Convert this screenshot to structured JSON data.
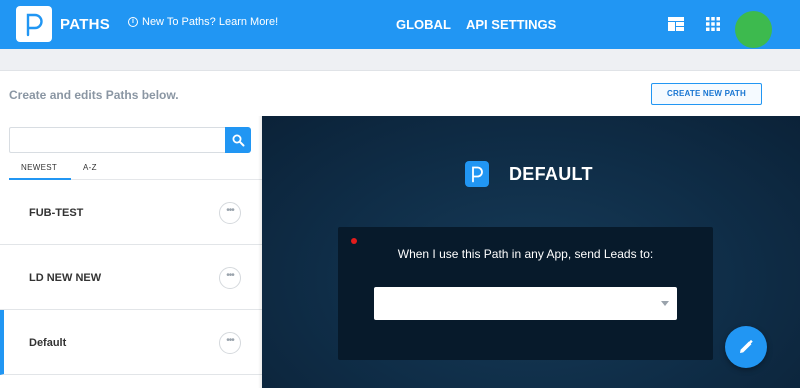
{
  "header": {
    "brand": "PATHS",
    "learn_more": "New To Paths? Learn More!",
    "nav": [
      {
        "label": "GLOBAL"
      },
      {
        "label": "API SETTINGS"
      }
    ],
    "icons": [
      "dashboard-icon",
      "apps-grid-icon",
      "user-avatar"
    ],
    "accent_color": "#2196f3",
    "avatar_color": "#3dba4e"
  },
  "subheader": {
    "subtitle": "Create and edits Paths below.",
    "create_button": "CREATE NEW PATH"
  },
  "sidebar": {
    "search": {
      "value": "",
      "placeholder": ""
    },
    "tabs": [
      {
        "label": "NEWEST",
        "selected": true
      },
      {
        "label": "A-Z",
        "selected": false
      }
    ],
    "items": [
      {
        "label": "FUB-TEST",
        "active": false
      },
      {
        "label": "LD NEW NEW",
        "active": false
      },
      {
        "label": "Default",
        "active": true
      }
    ],
    "more_label": "•••"
  },
  "detail": {
    "title": "DEFAULT",
    "prompt": "When I use this Path in any App, send Leads to:",
    "select_value": "",
    "background_color": "#0f2d47"
  },
  "fab": {
    "icon": "pencil-icon"
  }
}
